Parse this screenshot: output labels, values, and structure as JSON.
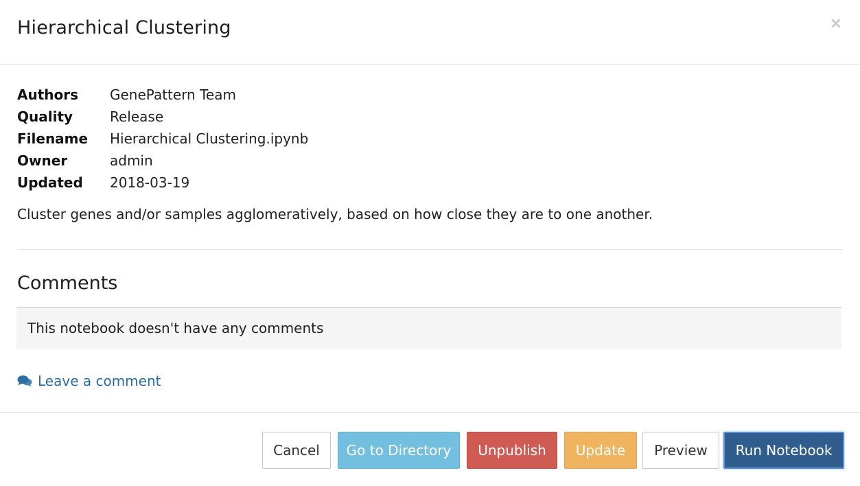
{
  "modal": {
    "title": "Hierarchical Clustering",
    "close_symbol": "×"
  },
  "meta": [
    {
      "key": "Authors",
      "value": "GenePattern Team"
    },
    {
      "key": "Quality",
      "value": "Release"
    },
    {
      "key": "Filename",
      "value": "Hierarchical Clustering.ipynb"
    },
    {
      "key": "Owner",
      "value": "admin"
    },
    {
      "key": "Updated",
      "value": "2018-03-19"
    }
  ],
  "description": "Cluster genes and/or samples agglomeratively, based on how close they are to one another.",
  "comments": {
    "heading": "Comments",
    "empty_text": "This notebook doesn't have any comments",
    "leave_label": "Leave a comment",
    "leave_icon": "comments-icon"
  },
  "footer": {
    "cancel": "Cancel",
    "go_to_directory": "Go to Directory",
    "unpublish": "Unpublish",
    "update": "Update",
    "preview": "Preview",
    "run_notebook": "Run Notebook"
  },
  "colors": {
    "link": "#2a6ea8",
    "directory": "#72bfe0",
    "unpublish": "#d05b53",
    "update": "#f0b35e",
    "run": "#2f5d8e"
  }
}
